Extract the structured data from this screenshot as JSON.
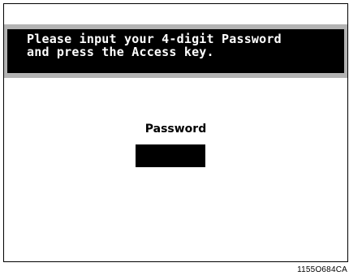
{
  "message": {
    "line1": "Please input your 4-digit Password",
    "line2": "and press the Access key."
  },
  "password": {
    "label": "Password",
    "value": ""
  },
  "figure_code": "1155O684CA"
}
